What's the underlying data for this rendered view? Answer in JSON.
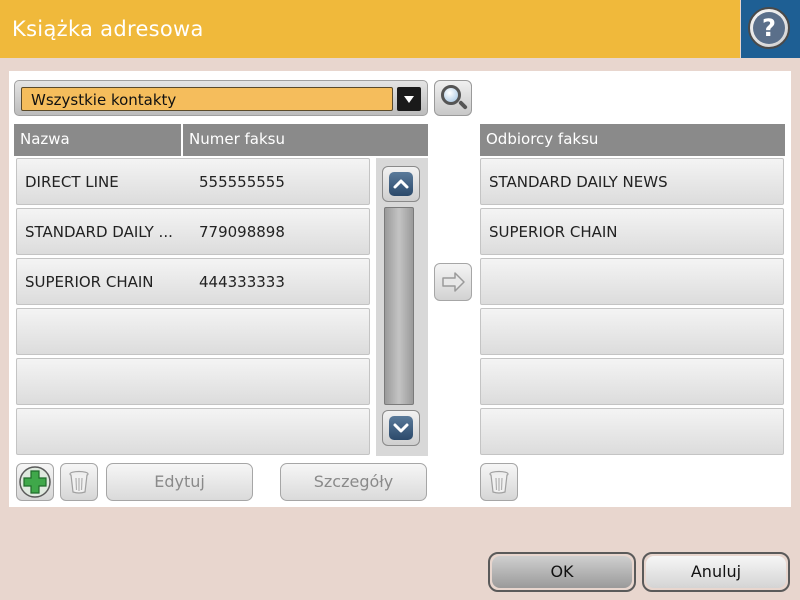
{
  "header": {
    "title": "Książka adresowa",
    "help_icon": "help-icon"
  },
  "filter": {
    "selected": "Wszystkie kontakty"
  },
  "columns": {
    "name": "Nazwa",
    "fax": "Numer faksu",
    "recipients": "Odbiorcy faksu"
  },
  "contacts": [
    {
      "name": "DIRECT LINE",
      "fax": "555555555"
    },
    {
      "name": "STANDARD DAILY ...",
      "fax": "779098898"
    },
    {
      "name": "SUPERIOR CHAIN",
      "fax": "444333333"
    },
    {
      "name": "",
      "fax": ""
    },
    {
      "name": "",
      "fax": ""
    },
    {
      "name": "",
      "fax": ""
    }
  ],
  "recipients": [
    {
      "name": "STANDARD DAILY NEWS"
    },
    {
      "name": "SUPERIOR CHAIN"
    },
    {
      "name": ""
    },
    {
      "name": ""
    },
    {
      "name": ""
    },
    {
      "name": ""
    }
  ],
  "toolbar": {
    "edit_label": "Edytuj",
    "details_label": "Szczegóły"
  },
  "footer": {
    "ok_label": "OK",
    "cancel_label": "Anuluj"
  },
  "colors": {
    "header": "#f0b93b",
    "dropdown_field": "#f5bd5c",
    "table_header": "#8a8a8a",
    "help_bg": "#1e5f94"
  }
}
